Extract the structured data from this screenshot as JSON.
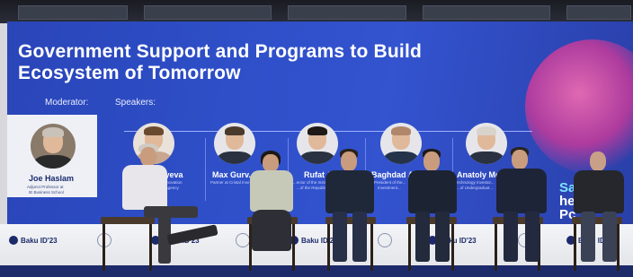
{
  "screen": {
    "title_line1": "Government Support and Programs to Build",
    "title_line2": "Ecosystem of Tomorrow",
    "moderator_label": "Moderator:",
    "speakers_label": "Speakers:",
    "moderator": {
      "name": "Joe Haslam",
      "sub1": "Adjunct Professor at",
      "sub2": "IE Business School"
    },
    "speakers": [
      {
        "name": "...yeva",
        "sub1": "...Innovation",
        "sub2": "...Agency"
      },
      {
        "name": "Max Gurv...",
        "sub1": "Partner at Cristal Inve...",
        "sub2": ""
      },
      {
        "name": "Rufat A...",
        "sub1": "...ector of the Instit...",
        "sub2": "...of the Republic..."
      },
      {
        "name": "Baghdad A...",
        "sub1": "President of the...",
        "sub2": "Investment..."
      },
      {
        "name": "Anatoly Mo...",
        "sub1": "Technology Investor...",
        "sub2": "...of Undergraduat..."
      }
    ],
    "slogan_line1": "Say",
    "slogan_line2": "hel",
    "slogan_line3": "Pc"
  },
  "stage_front": {
    "brand_items": [
      "Baku ID'23",
      "Baku ID'23",
      "Baku ID'23",
      "Baku ID'23",
      "Baku ID'23"
    ]
  },
  "colors": {
    "screen_blue": "#2e4fc8",
    "accent_pink": "#ff6fb2",
    "brand_navy": "#1b2a6b"
  }
}
